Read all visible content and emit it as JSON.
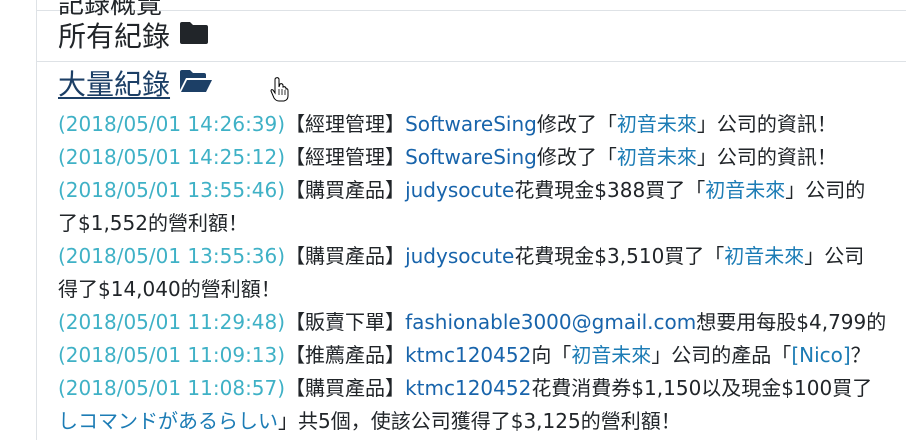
{
  "header": {
    "top_cut_title": "記錄概覽",
    "all_records": "所有紀錄",
    "bulk_records": "大量紀錄"
  },
  "entries": [
    {
      "lines": [
        [
          {
            "t": "(2018/05/01 14:26:39)",
            "c": "ts"
          },
          {
            "t": "【經理管理】",
            "c": "dark"
          },
          {
            "t": "SoftwareSing",
            "c": "user"
          },
          {
            "t": "修改了「",
            "c": "dark"
          },
          {
            "t": "初音未來",
            "c": "company"
          },
          {
            "t": "」公司的資訊！",
            "c": "dark"
          }
        ]
      ]
    },
    {
      "lines": [
        [
          {
            "t": "(2018/05/01 14:25:12)",
            "c": "ts"
          },
          {
            "t": "【經理管理】",
            "c": "dark"
          },
          {
            "t": "SoftwareSing",
            "c": "user"
          },
          {
            "t": "修改了「",
            "c": "dark"
          },
          {
            "t": "初音未來",
            "c": "company"
          },
          {
            "t": "」公司的資訊！",
            "c": "dark"
          }
        ]
      ]
    },
    {
      "lines": [
        [
          {
            "t": "(2018/05/01 13:55:46)",
            "c": "ts"
          },
          {
            "t": "【購買產品】",
            "c": "dark"
          },
          {
            "t": "judysocute",
            "c": "user"
          },
          {
            "t": "花費現金$388買了「",
            "c": "dark"
          },
          {
            "t": "初音未來",
            "c": "company"
          },
          {
            "t": "」公司的",
            "c": "dark"
          }
        ],
        [
          {
            "t": "了$1,552的營利額！",
            "c": "dark"
          }
        ]
      ]
    },
    {
      "lines": [
        [
          {
            "t": "(2018/05/01 13:55:36)",
            "c": "ts"
          },
          {
            "t": "【購買產品】",
            "c": "dark"
          },
          {
            "t": "judysocute",
            "c": "user"
          },
          {
            "t": "花費現金$3,510買了「",
            "c": "dark"
          },
          {
            "t": "初音未來",
            "c": "company"
          },
          {
            "t": "」公司",
            "c": "dark"
          }
        ],
        [
          {
            "t": "得了$14,040的營利額！",
            "c": "dark"
          }
        ]
      ]
    },
    {
      "lines": [
        [
          {
            "t": "(2018/05/01 11:29:48)",
            "c": "ts"
          },
          {
            "t": "【販賣下單】",
            "c": "dark"
          },
          {
            "t": "fashionable3000@gmail.com",
            "c": "user"
          },
          {
            "t": "想要用每股$4,799的",
            "c": "dark"
          }
        ]
      ]
    },
    {
      "lines": [
        [
          {
            "t": "(2018/05/01 11:09:13)",
            "c": "ts"
          },
          {
            "t": "【推薦產品】",
            "c": "dark"
          },
          {
            "t": "ktmc120452",
            "c": "user"
          },
          {
            "t": "向「",
            "c": "dark"
          },
          {
            "t": "初音未來",
            "c": "company"
          },
          {
            "t": "」公司的產品「",
            "c": "dark"
          },
          {
            "t": "[Nico]",
            "c": "company"
          },
          {
            "t": "？",
            "c": "dark"
          }
        ]
      ]
    },
    {
      "lines": [
        [
          {
            "t": "(2018/05/01 11:08:57)",
            "c": "ts"
          },
          {
            "t": "【購買產品】",
            "c": "dark"
          },
          {
            "t": "ktmc120452",
            "c": "user"
          },
          {
            "t": "花費消費券$1,150以及現金$100買了",
            "c": "dark"
          }
        ],
        [
          {
            "t": "しコマンドがあるらしい",
            "c": "company"
          },
          {
            "t": "」共5個，使該公司獲得了$3,125的營利額！",
            "c": "dark"
          }
        ]
      ]
    }
  ],
  "colors": {
    "timestamp": "#3fb1c6",
    "user": "#1864ab",
    "company": "#1c7cb5",
    "text": "#212529",
    "heading_link": "#1c3f66"
  },
  "icons": {
    "all_records_icon": "folder-closed-icon",
    "bulk_records_icon": "folder-open-icon",
    "cursor": "hand-pointer-icon"
  }
}
